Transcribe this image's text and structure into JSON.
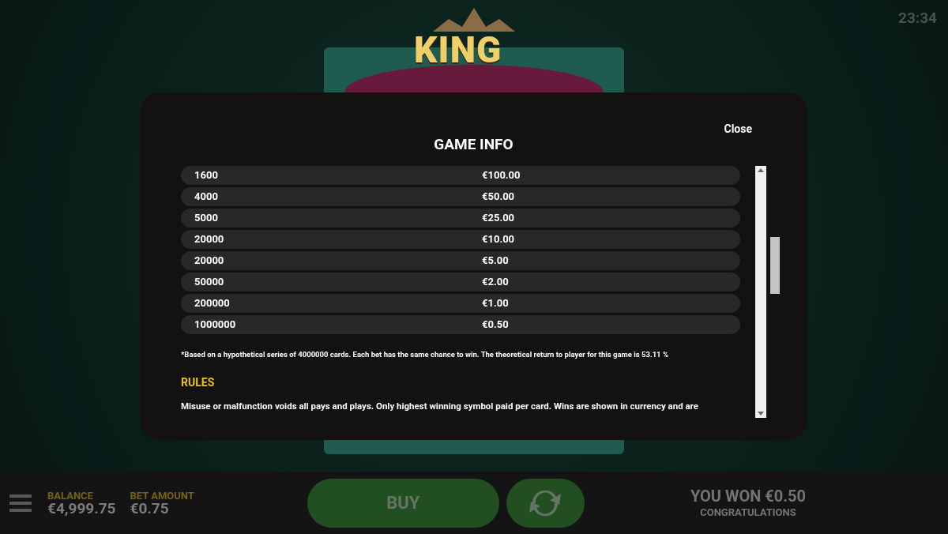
{
  "clock": "23:34",
  "game": {
    "logo": "KING"
  },
  "dialog": {
    "title": "GAME INFO",
    "close": "Close",
    "paytable": [
      {
        "column_1": "1600",
        "column_2": "€100.00"
      },
      {
        "column_1": "4000",
        "column_2": "€50.00"
      },
      {
        "column_1": "5000",
        "column_2": "€25.00"
      },
      {
        "column_1": "20000",
        "column_2": "€10.00"
      },
      {
        "column_1": "20000",
        "column_2": "€5.00"
      },
      {
        "column_1": "50000",
        "column_2": "€2.00"
      },
      {
        "column_1": "200000",
        "column_2": "€1.00"
      },
      {
        "column_1": "1000000",
        "column_2": "€0.50"
      }
    ],
    "note": "*Based on a hypothetical series of 4000000 cards. Each bet has the same chance to win. The theoretical return to player for this game is 53.11 %",
    "rules": {
      "heading": "RULES",
      "text": "Misuse or malfunction voids all pays and plays. Only highest winning symbol paid per card. Wins are shown in currency and are"
    }
  },
  "bottom_bar": {
    "balance": {
      "label": "BALANCE",
      "value": "€4,999.75"
    },
    "bet": {
      "label": "BET AMOUNT",
      "value": "€0.75"
    },
    "buy": "BUY",
    "win": {
      "title": "YOU WON €0.50",
      "subtitle": "CONGRATULATIONS"
    }
  }
}
